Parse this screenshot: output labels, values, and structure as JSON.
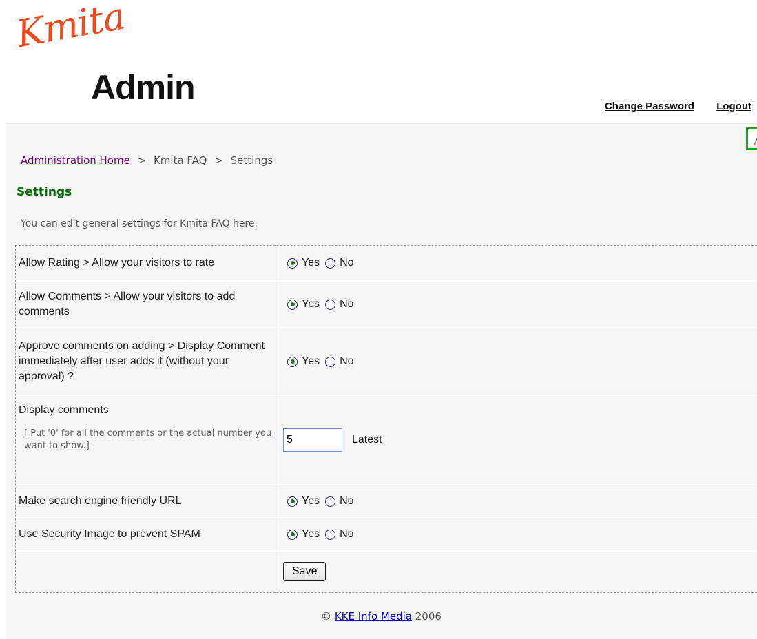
{
  "logo": {
    "script_text": "Kmita",
    "admin_text": "Admin"
  },
  "top_links": {
    "change_password": "Change Password",
    "logout": "Logout"
  },
  "breadcrumb": {
    "home": "Administration Home",
    "separator": ">",
    "section": "Kmita FAQ",
    "current": "Settings"
  },
  "page": {
    "title": "Settings",
    "intro": "You can edit general settings for Kmita FAQ here."
  },
  "settings": {
    "rows": [
      {
        "label": "Allow Rating > Allow your visitors to rate",
        "yes": "Yes",
        "no": "No",
        "selected": "Yes"
      },
      {
        "label": "Allow Comments > Allow your visitors to add comments",
        "yes": "Yes",
        "no": "No",
        "selected": "Yes"
      },
      {
        "label": "Approve comments on adding > Display Comment immediately after user adds it (without your approval) ?",
        "yes": "Yes",
        "no": "No",
        "selected": "Yes"
      },
      {
        "label": "Display comments",
        "hint": "[ Put '0' for all the comments or the actual number you want to show.]",
        "value": "5",
        "suffix": "Latest"
      },
      {
        "label": "Make search engine friendly URL",
        "yes": "Yes",
        "no": "No",
        "selected": "Yes"
      },
      {
        "label": "Use Security Image to prevent SPAM",
        "yes": "Yes",
        "no": "No",
        "selected": "Yes"
      }
    ],
    "save_label": "Save"
  },
  "footer": {
    "copyright": "©",
    "company": "KKE Info Media",
    "year": "2006"
  },
  "colors": {
    "title_green": "#0a6b0a",
    "logo_orange": "#ef4a1f",
    "panel_bg": "#f5f5f5"
  }
}
